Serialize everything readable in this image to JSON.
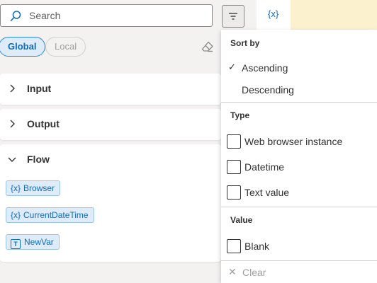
{
  "search": {
    "placeholder": "Search",
    "value": ""
  },
  "scope_tabs": {
    "global": "Global",
    "local": "Local"
  },
  "sections": {
    "input": {
      "title": "Input"
    },
    "output": {
      "title": "Output"
    },
    "flow": {
      "title": "Flow",
      "variables": [
        {
          "name": "Browser",
          "icon": "variable-icon"
        },
        {
          "name": "CurrentDateTime",
          "icon": "variable-icon"
        },
        {
          "name": "NewVar",
          "icon": "text-type-icon"
        }
      ]
    }
  },
  "background_tab": {
    "label": "{x}"
  },
  "filter_menu": {
    "sort_heading": "Sort by",
    "sort_options": [
      {
        "label": "Ascending",
        "selected": true
      },
      {
        "label": "Descending",
        "selected": false
      }
    ],
    "type_heading": "Type",
    "type_options": [
      {
        "label": "Web browser instance",
        "checked": false
      },
      {
        "label": "Datetime",
        "checked": false
      },
      {
        "label": "Text value",
        "checked": false
      }
    ],
    "value_heading": "Value",
    "value_options": [
      {
        "label": "Blank",
        "checked": false
      }
    ],
    "clear_label": "Clear"
  },
  "colors": {
    "accent": "#0f6cbd",
    "chip_bg": "#deecf9",
    "panel_bg": "#f3f2f1",
    "tab_bg_yellow": "#fcf1cf"
  }
}
